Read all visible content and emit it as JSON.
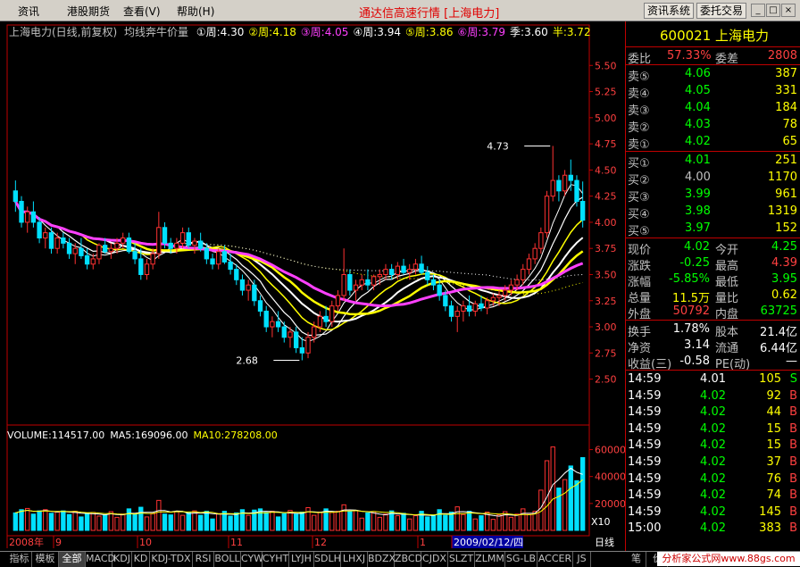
{
  "menu": {
    "items": [
      "资讯",
      "港股期货",
      "查看(V)",
      "帮助(H)"
    ],
    "title": "通达信高速行情 [上海电力]",
    "right_buttons": [
      "资讯系统",
      "委托交易"
    ],
    "window_controls": [
      "_",
      "□",
      "×"
    ]
  },
  "chart_header": {
    "stock": "上海电力(日线,前复权)",
    "indicator": "均线奔牛价量",
    "ma": [
      {
        "label": "①周:4.30",
        "color": "#ffffff"
      },
      {
        "label": "②周:4.18",
        "color": "#ffff00"
      },
      {
        "label": "③周:4.05",
        "color": "#ff40ff"
      },
      {
        "label": "④周:3.94",
        "color": "#ffffff"
      },
      {
        "label": "⑤周:3.86",
        "color": "#ffff00"
      },
      {
        "label": "⑥周:3.79",
        "color": "#ff40ff"
      },
      {
        "label": "季:3.60",
        "color": "#ffffff"
      },
      {
        "label": "半:3.72",
        "color": "#ffff00"
      }
    ]
  },
  "chart_data": {
    "type": "candlestick",
    "ylim": [
      2.3,
      5.75
    ],
    "y_ticks": [
      "5.50",
      "5.25",
      "5.00",
      "4.75",
      "4.50",
      "4.25",
      "4.00",
      "3.75",
      "3.50",
      "3.25",
      "3.00",
      "2.75",
      "2.50"
    ],
    "annotations": [
      {
        "text": "4.73",
        "value": 4.73
      },
      {
        "text": "2.68",
        "value": 2.68
      }
    ],
    "x_labels": [
      "2008年",
      "9",
      "10",
      "11",
      "12",
      "1",
      "2009/02/12/四"
    ],
    "candles": [
      [
        4.3,
        4.4,
        4.1,
        4.2
      ],
      [
        4.2,
        4.25,
        3.95,
        4.0
      ],
      [
        4.0,
        4.15,
        3.9,
        4.1
      ],
      [
        4.1,
        4.2,
        3.95,
        4.0
      ],
      [
        4.0,
        4.05,
        3.8,
        3.85
      ],
      [
        3.85,
        3.95,
        3.75,
        3.9
      ],
      [
        3.9,
        3.95,
        3.7,
        3.75
      ],
      [
        3.75,
        3.9,
        3.7,
        3.85
      ],
      [
        3.85,
        3.9,
        3.75,
        3.8
      ],
      [
        3.8,
        3.85,
        3.65,
        3.7
      ],
      [
        3.7,
        3.8,
        3.6,
        3.75
      ],
      [
        3.75,
        3.85,
        3.65,
        3.68
      ],
      [
        3.68,
        3.75,
        3.55,
        3.6
      ],
      [
        3.6,
        3.7,
        3.55,
        3.65
      ],
      [
        3.65,
        3.8,
        3.6,
        3.78
      ],
      [
        3.78,
        3.85,
        3.7,
        3.72
      ],
      [
        3.72,
        3.8,
        3.65,
        3.75
      ],
      [
        3.75,
        3.85,
        3.7,
        3.8
      ],
      [
        3.8,
        3.9,
        3.75,
        3.85
      ],
      [
        3.85,
        3.9,
        3.7,
        3.72
      ],
      [
        3.72,
        3.8,
        3.6,
        3.65
      ],
      [
        3.65,
        3.75,
        3.45,
        3.5
      ],
      [
        3.5,
        3.65,
        3.45,
        3.6
      ],
      [
        3.6,
        3.75,
        3.55,
        3.7
      ],
      [
        3.7,
        4.1,
        3.65,
        3.95
      ],
      [
        3.95,
        4.0,
        3.75,
        3.8
      ],
      [
        3.8,
        3.85,
        3.7,
        3.75
      ],
      [
        3.75,
        3.85,
        3.7,
        3.8
      ],
      [
        3.8,
        3.95,
        3.75,
        3.9
      ],
      [
        3.9,
        3.95,
        3.75,
        3.78
      ],
      [
        3.78,
        3.85,
        3.7,
        3.82
      ],
      [
        3.82,
        3.9,
        3.72,
        3.75
      ],
      [
        3.75,
        3.8,
        3.6,
        3.65
      ],
      [
        3.65,
        3.7,
        3.55,
        3.6
      ],
      [
        3.6,
        3.75,
        3.55,
        3.72
      ],
      [
        3.72,
        3.78,
        3.6,
        3.62
      ],
      [
        3.62,
        3.7,
        3.5,
        3.55
      ],
      [
        3.55,
        3.6,
        3.4,
        3.45
      ],
      [
        3.45,
        3.5,
        3.3,
        3.35
      ],
      [
        3.35,
        3.45,
        3.25,
        3.4
      ],
      [
        3.4,
        3.45,
        3.2,
        3.25
      ],
      [
        3.25,
        3.3,
        3.1,
        3.15
      ],
      [
        3.15,
        3.2,
        2.95,
        3.0
      ],
      [
        3.0,
        3.1,
        2.9,
        3.05
      ],
      [
        3.05,
        3.15,
        2.95,
        3.0
      ],
      [
        3.0,
        3.05,
        2.85,
        2.9
      ],
      [
        2.9,
        3.0,
        2.8,
        2.95
      ],
      [
        2.95,
        3.0,
        2.75,
        2.8
      ],
      [
        2.8,
        2.9,
        2.68,
        2.75
      ],
      [
        2.75,
        2.95,
        2.7,
        2.9
      ],
      [
        2.9,
        3.05,
        2.85,
        3.0
      ],
      [
        3.0,
        3.15,
        2.95,
        3.1
      ],
      [
        3.1,
        3.2,
        3.0,
        3.05
      ],
      [
        3.05,
        3.25,
        3.0,
        3.2
      ],
      [
        3.2,
        3.35,
        3.15,
        3.3
      ],
      [
        3.3,
        3.75,
        3.25,
        3.5
      ],
      [
        3.5,
        3.55,
        3.3,
        3.35
      ],
      [
        3.35,
        3.45,
        3.25,
        3.4
      ],
      [
        3.4,
        3.5,
        3.35,
        3.45
      ],
      [
        3.45,
        3.55,
        3.35,
        3.4
      ],
      [
        3.4,
        3.5,
        3.35,
        3.48
      ],
      [
        3.48,
        3.55,
        3.4,
        3.5
      ],
      [
        3.5,
        3.6,
        3.45,
        3.55
      ],
      [
        3.55,
        3.6,
        3.45,
        3.5
      ],
      [
        3.5,
        3.62,
        3.45,
        3.58
      ],
      [
        3.58,
        3.65,
        3.5,
        3.52
      ],
      [
        3.52,
        3.6,
        3.45,
        3.55
      ],
      [
        3.55,
        3.65,
        3.5,
        3.6
      ],
      [
        3.6,
        3.68,
        3.5,
        3.52
      ],
      [
        3.52,
        3.58,
        3.4,
        3.45
      ],
      [
        3.45,
        3.5,
        3.35,
        3.4
      ],
      [
        3.4,
        3.45,
        3.25,
        3.3
      ],
      [
        3.3,
        3.35,
        3.15,
        3.2
      ],
      [
        3.2,
        3.25,
        3.05,
        3.1
      ],
      [
        3.1,
        3.2,
        2.95,
        3.15
      ],
      [
        3.15,
        3.25,
        3.05,
        3.2
      ],
      [
        3.2,
        3.3,
        3.1,
        3.15
      ],
      [
        3.15,
        3.25,
        3.1,
        3.22
      ],
      [
        3.22,
        3.3,
        3.15,
        3.18
      ],
      [
        3.18,
        3.28,
        3.12,
        3.25
      ],
      [
        3.25,
        3.32,
        3.2,
        3.28
      ],
      [
        3.28,
        3.35,
        3.2,
        3.3
      ],
      [
        3.3,
        3.4,
        3.25,
        3.35
      ],
      [
        3.35,
        3.45,
        3.3,
        3.4
      ],
      [
        3.4,
        3.5,
        3.35,
        3.45
      ],
      [
        3.45,
        3.6,
        3.4,
        3.55
      ],
      [
        3.55,
        3.7,
        3.5,
        3.65
      ],
      [
        3.65,
        3.8,
        3.6,
        3.75
      ],
      [
        3.75,
        3.95,
        3.7,
        3.9
      ],
      [
        3.9,
        4.3,
        3.85,
        4.25
      ],
      [
        4.25,
        4.73,
        4.2,
        4.4
      ],
      [
        4.4,
        4.45,
        4.2,
        4.3
      ],
      [
        4.3,
        4.5,
        4.25,
        4.45
      ],
      [
        4.45,
        4.6,
        4.3,
        4.4
      ],
      [
        4.4,
        4.45,
        4.15,
        4.2
      ],
      [
        4.2,
        4.39,
        3.95,
        4.02
      ]
    ],
    "volume_ylim": [
      0,
      65000
    ],
    "volume_ticks": [
      "60000",
      "40000",
      "20000"
    ],
    "volume_unit": "X10",
    "volume_header": [
      {
        "label": "VOLUME:114517.00",
        "color": "#ffffff"
      },
      {
        "label": "MA5:169096.00",
        "color": "#ffffff"
      },
      {
        "label": "MA10:278208.00",
        "color": "#ffff00"
      }
    ]
  },
  "quote": {
    "code_name": "600021 上海电力",
    "ratio_label": "委比",
    "ratio": "57.33%",
    "diff_label": "委差",
    "diff": "2808",
    "sells": [
      {
        "label": "卖⑤",
        "price": "4.06",
        "vol": "387"
      },
      {
        "label": "卖④",
        "price": "4.05",
        "vol": "331"
      },
      {
        "label": "卖③",
        "price": "4.04",
        "vol": "184"
      },
      {
        "label": "卖②",
        "price": "4.03",
        "vol": "78"
      },
      {
        "label": "卖①",
        "price": "4.02",
        "vol": "65"
      }
    ],
    "buys": [
      {
        "label": "买①",
        "price": "4.01",
        "vol": "251"
      },
      {
        "label": "买②",
        "price": "4.00",
        "vol": "1170"
      },
      {
        "label": "买③",
        "price": "3.99",
        "vol": "961"
      },
      {
        "label": "买④",
        "price": "3.98",
        "vol": "1319"
      },
      {
        "label": "买⑤",
        "price": "3.97",
        "vol": "152"
      }
    ],
    "stats": [
      {
        "l1": "现价",
        "v1": "4.02",
        "c1": "#00ff00",
        "l2": "今开",
        "v2": "4.25",
        "c2": "#00ff00"
      },
      {
        "l1": "涨跌",
        "v1": "-0.25",
        "c1": "#00ff00",
        "l2": "最高",
        "v2": "4.39",
        "c2": "#ff4040"
      },
      {
        "l1": "涨幅",
        "v1": "-5.85%",
        "c1": "#00ff00",
        "l2": "最低",
        "v2": "3.95",
        "c2": "#00ff00"
      },
      {
        "l1": "总量",
        "v1": "11.5万",
        "c1": "#ffff00",
        "l2": "量比",
        "v2": "0.62",
        "c2": "#ffff00"
      },
      {
        "l1": "外盘",
        "v1": "50792",
        "c1": "#ff4040",
        "l2": "内盘",
        "v2": "63725",
        "c2": "#00ff00"
      }
    ],
    "fund": [
      {
        "l1": "换手",
        "v1": "1.78%",
        "l2": "股本",
        "v2": "21.4亿"
      },
      {
        "l1": "净资",
        "v1": "3.14",
        "l2": "流通",
        "v2": "6.44亿"
      },
      {
        "l1": "收益(三)",
        "v1": "-0.58",
        "l2": "PE(动)",
        "v2": "—"
      }
    ],
    "ticks": [
      {
        "time": "14:59",
        "price": "4.01",
        "vol": "105",
        "bs": "S"
      },
      {
        "time": "14:59",
        "price": "4.02",
        "vol": "92",
        "bs": "B"
      },
      {
        "time": "14:59",
        "price": "4.02",
        "vol": "44",
        "bs": "B"
      },
      {
        "time": "14:59",
        "price": "4.02",
        "vol": "15",
        "bs": "B"
      },
      {
        "time": "14:59",
        "price": "4.02",
        "vol": "15",
        "bs": "B"
      },
      {
        "time": "14:59",
        "price": "4.02",
        "vol": "37",
        "bs": "B"
      },
      {
        "time": "14:59",
        "price": "4.02",
        "vol": "76",
        "bs": "B"
      },
      {
        "time": "14:59",
        "price": "4.02",
        "vol": "74",
        "bs": "B"
      },
      {
        "time": "14:59",
        "price": "4.02",
        "vol": "145",
        "bs": "B"
      },
      {
        "time": "15:00",
        "price": "4.02",
        "vol": "383",
        "bs": "B"
      }
    ]
  },
  "period_label": "日线",
  "tabs": [
    "指标",
    "模板",
    "全部",
    "MACD",
    "KDJ",
    "KD",
    "KDJ-TDX",
    "RSI",
    "BOLL",
    "CYW",
    "CYHT",
    "LYJH",
    "SDLH",
    "LHXJ",
    "BDZX",
    "ZBCD",
    "CJDX",
    "SLZT",
    "ZLMM",
    "SG-LB",
    "ACCER",
    "JS",
    "笔",
    "价"
  ],
  "footer": "分析家公式网www.88gs.com",
  "colors": {
    "up": "#ff3232",
    "down": "#00e0ff",
    "axis": "#c00000",
    "label": "#ff4040"
  }
}
